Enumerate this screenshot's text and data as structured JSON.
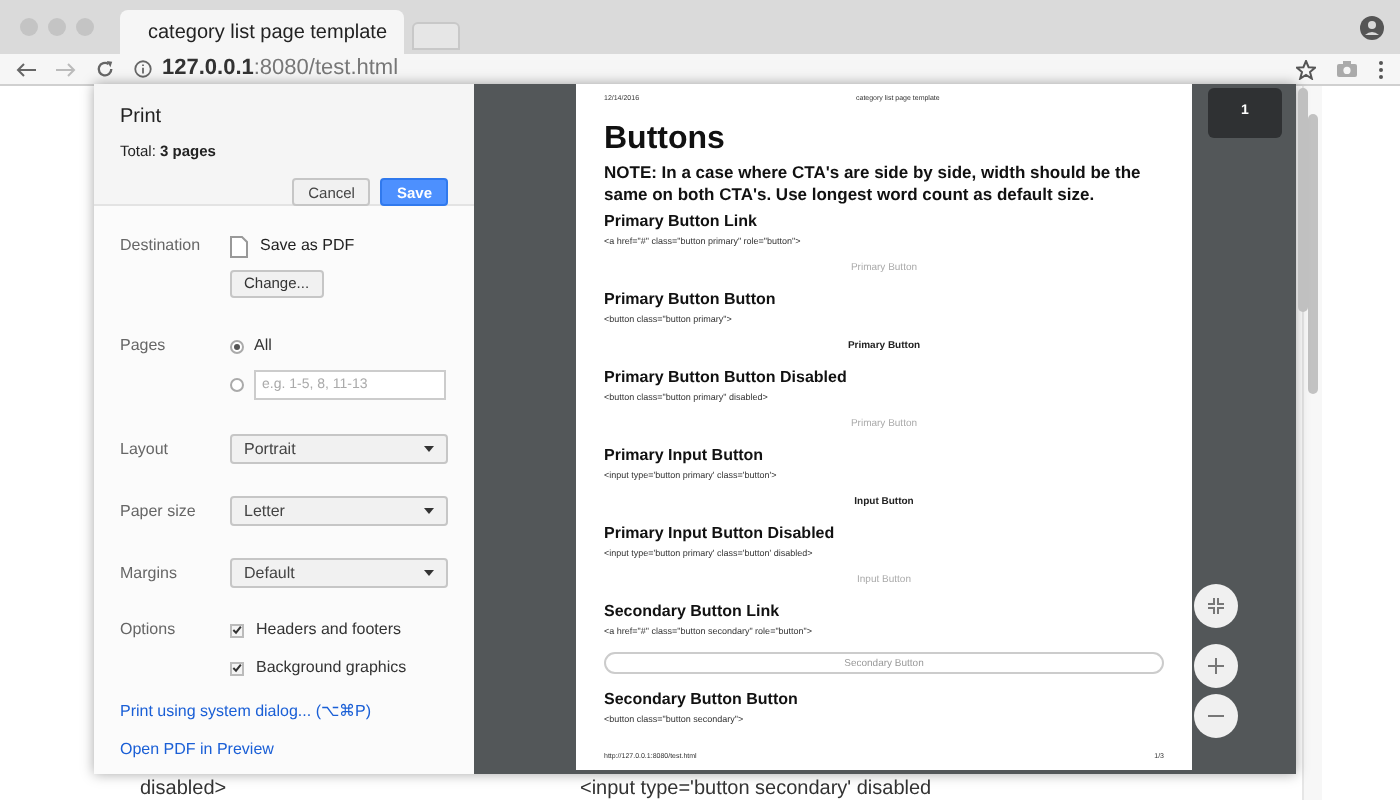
{
  "browser": {
    "tab_title": "category list page template",
    "url_host": "127.0.0.1",
    "url_rest": ":8080/test.html"
  },
  "background_page": [
    "disabled>",
    "<input type='button secondary' disabled"
  ],
  "print_dialog": {
    "title": "Print",
    "total": "Total: **3 pages**",
    "buttons": [
      {
        "label": "Cancel",
        "kind": "secondary"
      },
      {
        "label": "Save",
        "kind": "primary"
      }
    ],
    "destination": {
      "label": "Destination",
      "value": "Save as PDF",
      "change": "Change..."
    },
    "pages": {
      "label": "Pages",
      "options": [
        {
          "label": "All",
          "selected": true
        },
        {
          "placeholder": "e.g. 1-5, 8, 11-13",
          "selected": false
        }
      ]
    },
    "selects": [
      {
        "label": "Layout",
        "value": "Portrait"
      },
      {
        "label": "Paper size",
        "value": "Letter"
      },
      {
        "label": "Margins",
        "value": "Default"
      }
    ],
    "options": {
      "label": "Options",
      "items": [
        {
          "label": "Headers and footers",
          "checked": true
        },
        {
          "label": "Background graphics",
          "checked": true
        }
      ]
    },
    "links": [
      "Print using system dialog... (⌥⌘P)",
      "Open PDF in Preview"
    ]
  },
  "preview": {
    "header_left": "12/14/2016",
    "header_center": "category list page template",
    "heading": "Buttons",
    "note": "NOTE: In a case where CTA's are side by side, width should be the same on both CTA's. Use longest word count as default size.",
    "sections": [
      {
        "title": "Primary Button Link",
        "code": "<a href=\"#\" class=\"button primary\" role=\"button\">",
        "sample": "Primary Button",
        "kind": "muted"
      },
      {
        "title": "Primary Button Button",
        "code": "<button class=\"button primary\">",
        "sample": "Primary Button",
        "kind": "bold"
      },
      {
        "title": "Primary Button Button Disabled",
        "code": "<button class=\"button primary\" disabled>",
        "sample": "Primary Button",
        "kind": "muted"
      },
      {
        "title": "Primary Input Button",
        "code": "<input type='button primary' class='button'>",
        "sample": "Input Button",
        "kind": "bold"
      },
      {
        "title": "Primary Input Button Disabled",
        "code": "<input type='button primary' class='button' disabled>",
        "sample": "Input Button",
        "kind": "muted"
      },
      {
        "title": "Secondary Button Link",
        "code": "<a href=\"#\" class=\"button secondary\" role=\"button\">",
        "sample": "Secondary Button",
        "kind": "outline"
      },
      {
        "title": "Secondary Button Button",
        "code": "<button class=\"button secondary\">"
      }
    ],
    "footer_left": "http://127.0.0.1:8080/test.html",
    "footer_right": "1/3",
    "thumbnail": "1"
  }
}
